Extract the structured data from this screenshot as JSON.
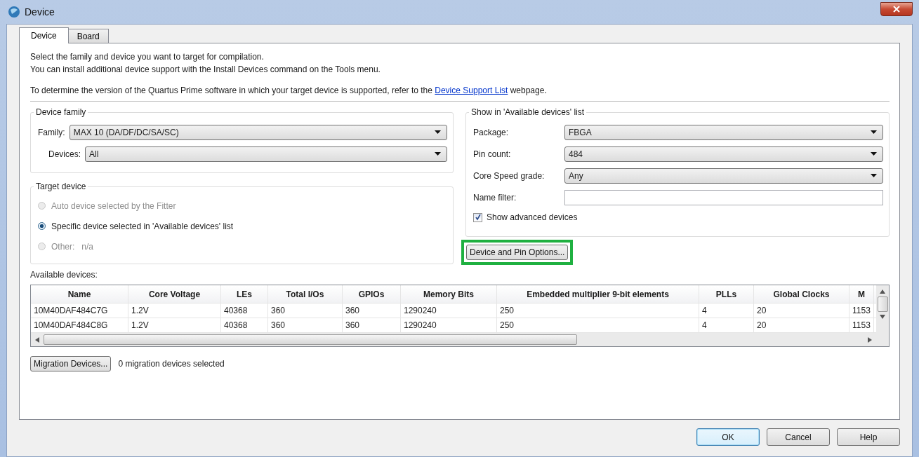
{
  "window": {
    "title": "Device"
  },
  "tabs": [
    {
      "label": "Device",
      "selected": true
    },
    {
      "label": "Board",
      "selected": false
    }
  ],
  "intro": [
    "Select the family and device you want to target for compilation.",
    "You can install additional device support with the Install Devices command on the Tools menu."
  ],
  "support_note": {
    "before": "To determine the version of the Quartus Prime software in which your target device is supported, refer to the ",
    "link": "Device Support List",
    "after": " webpage."
  },
  "device_family": {
    "title": "Device family",
    "fields": [
      {
        "label": "Family:",
        "value": "MAX 10 (DA/DF/DC/SA/SC)"
      },
      {
        "label": "Devices:",
        "value": "All"
      }
    ]
  },
  "target_device": {
    "title": "Target device",
    "options": [
      {
        "label": "Auto device selected by the Fitter",
        "selected": false,
        "disabled": true
      },
      {
        "label": "Specific device selected in 'Available devices' list",
        "selected": true,
        "disabled": false
      },
      {
        "label": "Other:",
        "value": "n/a",
        "selected": false,
        "disabled": true
      }
    ]
  },
  "filters": {
    "title": "Show in 'Available devices' list",
    "fields": [
      {
        "kind": "dropdown",
        "label": "Package:",
        "value": "FBGA"
      },
      {
        "kind": "dropdown",
        "label": "Pin count:",
        "value": "484"
      },
      {
        "kind": "dropdown",
        "label": "Core Speed grade:",
        "value": "Any"
      },
      {
        "kind": "text",
        "label": "Name filter:"
      }
    ],
    "show_advanced": {
      "label": "Show advanced devices",
      "checked": true
    }
  },
  "options_button": {
    "label": "Device and Pin Options...",
    "highlighted": true
  },
  "available": {
    "label": "Available devices:",
    "columns": [
      "Name",
      "Core Voltage",
      "LEs",
      "Total I/Os",
      "GPIOs",
      "Memory Bits",
      "Embedded multiplier 9-bit elements",
      "PLLs",
      "Global Clocks",
      "M"
    ],
    "rows": [
      [
        "10M40DAF484C7G",
        "1.2V",
        "40368",
        "360",
        "360",
        "1290240",
        "250",
        "4",
        "20",
        "1153"
      ],
      [
        "10M40DAF484C8G",
        "1.2V",
        "40368",
        "360",
        "360",
        "1290240",
        "250",
        "4",
        "20",
        "1153"
      ]
    ]
  },
  "migration": {
    "button": "Migration Devices...",
    "status": "0 migration devices selected"
  },
  "buttons": [
    {
      "label": "OK",
      "default": true
    },
    {
      "label": "Cancel",
      "default": false
    },
    {
      "label": "Help",
      "default": false
    }
  ]
}
